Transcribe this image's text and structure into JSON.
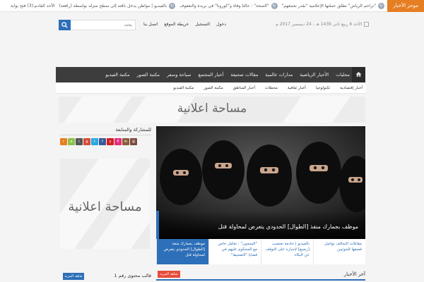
{
  "ticker": {
    "label": "موجز الأخبار",
    "items": [
      "\"تراحم الرياض\" تطلق حملتها الإعلامية \"نقدر تجمعهم\"",
      "\"الصحة\" : حالتا وفاة و\"كورونا\" في بريدة والنعفوف",
      "بالفيديو | مواطن يدخل ناقته إلى سطح منزله بواسطة (رافعة)",
      "الأحد القادم:(3) فتح بوابة"
    ],
    "icon": "refresh-icon"
  },
  "header": {
    "date": "الأحد 6 ربيع ثاني 1439 هـ - 24 ديسمبر 2017 م",
    "links": [
      "دخول",
      "التسجيل",
      "خريطة الموقع",
      "اتصل بنا"
    ],
    "search": {
      "placeholder": "بحث"
    }
  },
  "main_nav": {
    "home_icon": "home-icon",
    "items": [
      "محليات",
      "الأخبار الرياضية",
      "مدارات عالمية",
      "مقالات صحيفة",
      "أخبار المجتمع",
      "سياحة وسفر",
      "مكتبة الصور",
      "مكتبة الفيديو"
    ]
  },
  "sub_nav": {
    "items": [
      "أخبار إقتصادية",
      "تكنولوجيا",
      "أخبار ثقافية",
      "محطات",
      "أخبار المناطق",
      "مكتبة الصور",
      "مكتبة الفيديو"
    ]
  },
  "banner_ad": {
    "text": "مساحة اعلانية"
  },
  "sidebar": {
    "title": "للمشاركة والمتابعة",
    "social": [
      {
        "name": "rss-icon",
        "glyph": "r",
        "color": "#e67e22"
      },
      {
        "name": "android-icon",
        "glyph": "a",
        "color": "#8bc34a"
      },
      {
        "name": "apple-icon",
        "glyph": "i",
        "color": "#555555"
      },
      {
        "name": "google-plus-icon",
        "glyph": "g",
        "color": "#d84b37"
      },
      {
        "name": "twitter-icon",
        "glyph": "t",
        "color": "#29a9e1"
      },
      {
        "name": "facebook-icon",
        "glyph": "f",
        "color": "#3b5998"
      },
      {
        "name": "youtube-icon",
        "glyph": "y",
        "color": "#cc2020"
      },
      {
        "name": "flickr-icon",
        "glyph": "fl",
        "color": "#e62c78"
      },
      {
        "name": "instagram-icon",
        "glyph": "in",
        "color": "#8a5a3c"
      },
      {
        "name": "email-icon",
        "glyph": "@",
        "color": "#7a4a3a"
      }
    ],
    "ad_text": "مساحة اعلانية",
    "block_title": "قالب محتوى رقم 1",
    "more_label": "شاهد المزيد"
  },
  "slider": {
    "caption": "موظف بجمارك منفذ [الطوال] الحدودي يتعرض لمحاولة قتل"
  },
  "thumbs": [
    "موظف بجمارك منفذ [الطوال] الحدودي يتعرض لمحاولة قتل",
    "\"السجون\" : تعامل خاص مع المحكوم عليهم في قضايا \"التفحيط\"",
    "بالفيديو | خادمة تغتصب [رضيع] لإجباره على التوقف عن البكاء",
    "مقاتلات التحالف تواصل قصفها للحوثيين"
  ],
  "latest": {
    "title": "آخر الأخبار",
    "more_label": "شاهد المزيد"
  },
  "colors": {
    "accent": "#2d6fb8",
    "ticker": "#e67e22",
    "nav": "#3d3d3d",
    "more_red": "#e74c3c"
  }
}
